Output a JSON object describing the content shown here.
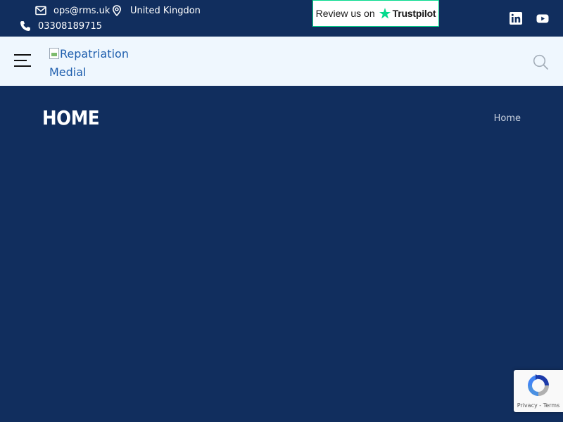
{
  "topbar": {
    "email": "ops@rms.uk",
    "location": "United Kingdon",
    "phone": "03308189715",
    "email_icon": "mail-icon",
    "location_icon": "map-pin-icon",
    "phone_icon": "phone-icon",
    "social_icons": [
      "linkedin-icon",
      "youtube-icon"
    ]
  },
  "trustpilot": {
    "prefix": "Review us on",
    "brand": "Trustpilot",
    "star_color": "#04da8d"
  },
  "header": {
    "logo_alt": "Repatriation Medial",
    "menu_icon": "hamburger-menu-icon",
    "search_icon": "search-icon"
  },
  "banner": {
    "title": "HOME",
    "breadcrumb": "Home"
  },
  "recaptcha": {
    "privacy": "Privacy",
    "separator": " - ",
    "terms": "Terms"
  },
  "colors": {
    "navy": "#112e5e",
    "header_bg": "#eff7fe",
    "link_blue": "#1f5fae",
    "trustpilot_green": "#04da8d"
  }
}
